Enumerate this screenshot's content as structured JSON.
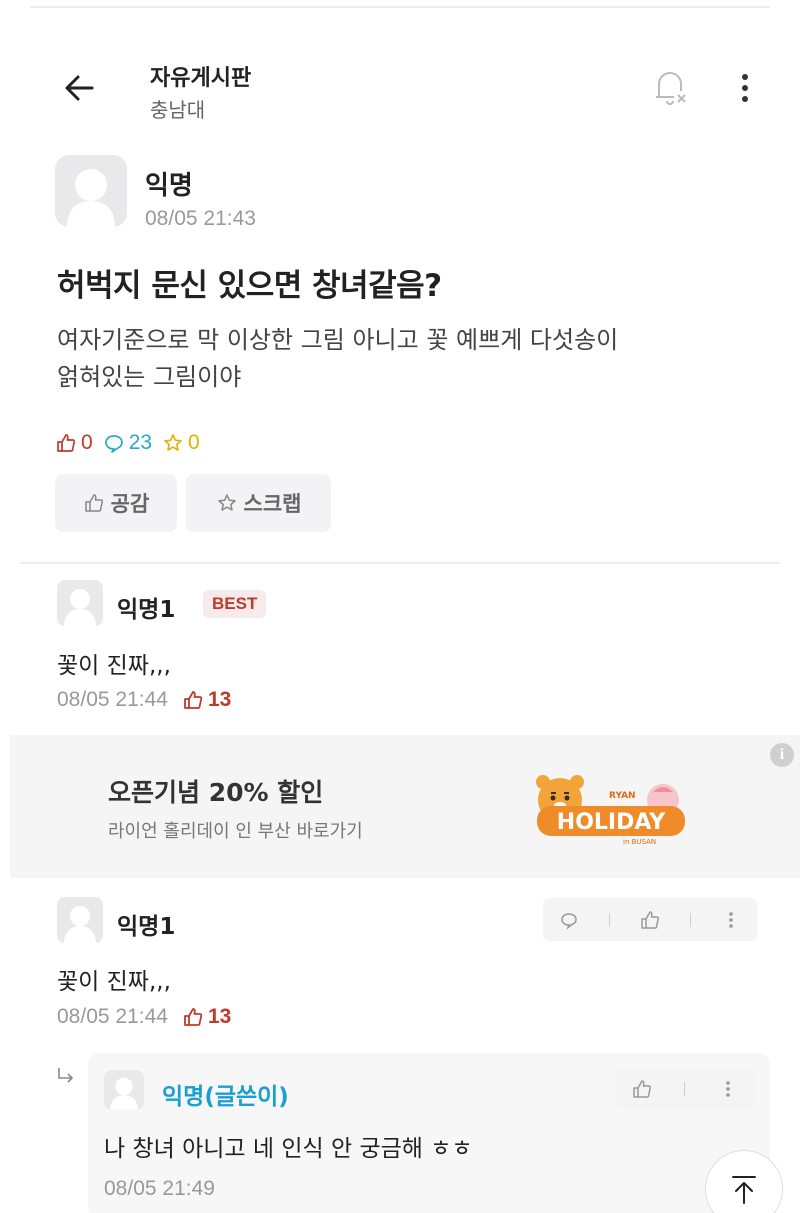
{
  "header": {
    "title": "자유게시판",
    "subtitle": "충남대"
  },
  "post": {
    "author": "익명",
    "date": "08/05 21:43",
    "title": "허벅지 문신 있으면 창녀같음?",
    "body_line1": "여자기준으로 막 이상한 그림 아니고 꽃 예쁘게 다섯송이",
    "body_line2": "얽혀있는 그림이야",
    "likes": "0",
    "comments": "23",
    "scraps": "0",
    "like_button": "공감",
    "scrap_button": "스크랩"
  },
  "best_comment": {
    "author": "익명1",
    "badge": "BEST",
    "text": "꽃이 진짜,,,",
    "date": "08/05 21:44",
    "likes": "13"
  },
  "ad": {
    "title": "오픈기념 20% 할인",
    "subtitle": "라이언 홀리데이 인 부산 바로가기",
    "info": "i",
    "logo_text": "HOLIDAY",
    "logo_small": "RYAN",
    "logo_tiny": "in BUSAN"
  },
  "comment": {
    "author": "익명1",
    "text": "꽃이 진짜,,,",
    "date": "08/05 21:44",
    "likes": "13"
  },
  "reply": {
    "author": "익명(글쓴이)",
    "text": "나 창녀 아니고 네 인식 안 궁금해 ㅎㅎ",
    "date": "08/05 21:49"
  },
  "colors": {
    "like": "#c0392b",
    "comment": "#2aa8c6",
    "scrap": "#e0b400",
    "author_reply": "#1a9fd0"
  }
}
